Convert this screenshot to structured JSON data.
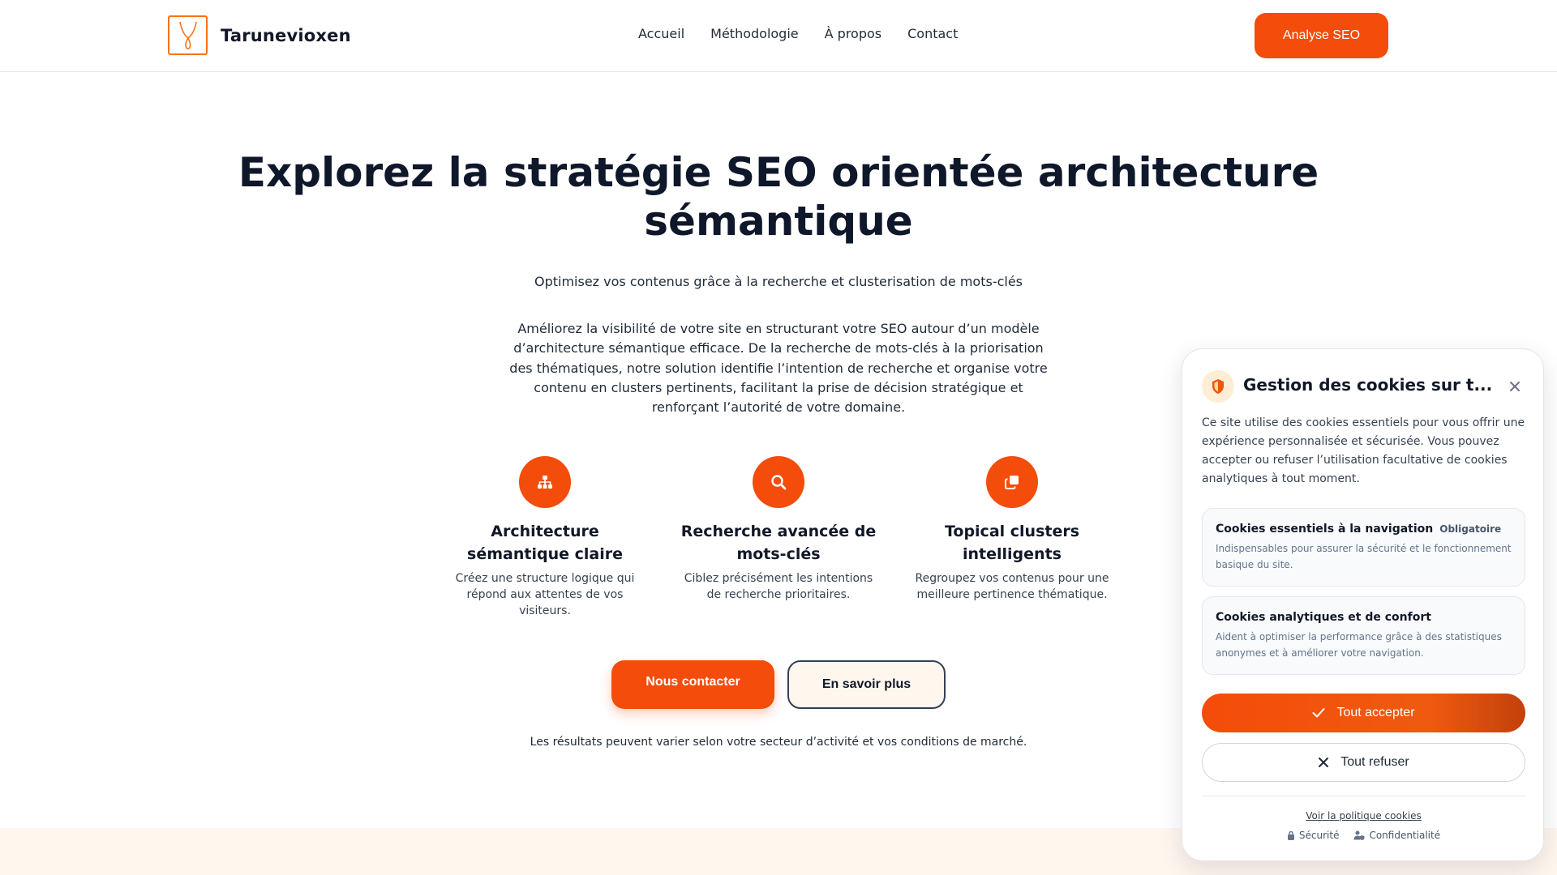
{
  "header": {
    "brand": "Tarunevioxen",
    "nav": [
      "Accueil",
      "Méthodologie",
      "À propos",
      "Contact"
    ],
    "cta": "Analyse SEO"
  },
  "hero": {
    "title_line1": "Explorez la stratégie SEO orientée architecture",
    "title_line2": "sémantique",
    "subtitle": "Optimisez vos contenus grâce à la recherche et clusterisation de mots-clés",
    "description": "Améliorez la visibilité de votre site en structurant votre SEO autour d’un modèle d’architecture sémantique efficace. De la recherche de mots-clés à la priorisation des thématiques, notre solution identifie l’intention de recherche et organise votre contenu en clusters pertinents, facilitant la prise de décision stratégique et renforçant l’autorité de votre domaine."
  },
  "features": [
    {
      "icon": "sitemap-icon",
      "title": "Architecture sémantique claire",
      "text": "Créez une structure logique qui répond aux attentes de vos visiteurs."
    },
    {
      "icon": "search-icon",
      "title": "Recherche avancée de mots-clés",
      "text": "Ciblez précisément les intentions de recherche prioritaires."
    },
    {
      "icon": "clone-icon",
      "title": "Topical clusters intelligents",
      "text": "Regroupez vos contenus pour une meilleure pertinence thématique."
    }
  ],
  "actions": {
    "contact": "Nous contacter",
    "more": "En savoir plus"
  },
  "disclaimer": "Les résultats peuvent varier selon votre secteur d’activité et vos conditions de marché.",
  "cookies": {
    "title": "Gestion des cookies sur t...",
    "description": "Ce site utilise des cookies essentiels pour vous offrir une expérience personnalisée et sécurisée. Vous pouvez accepter ou refuser l’utilisation facultative de cookies analytiques à tout moment.",
    "essential_title": "Cookies essentiels à la navigation",
    "essential_badge": "Obligatoire",
    "essential_desc": "Indispensables pour assurer la sécurité et le fonctionnement basique du site.",
    "analytics_title": "Cookies analytiques et de confort",
    "analytics_desc": "Aident à optimiser la performance grâce à des statistiques anonymes et à améliorer votre navigation.",
    "accept": "Tout accepter",
    "refuse": "Tout refuser",
    "policy": "Voir la politique cookies",
    "footer_security": "Sécurité",
    "footer_privacy": "Confidentialité"
  },
  "colors": {
    "accent": "#f44c0a",
    "text_dark": "#0f172a",
    "band": "#fff6ee"
  }
}
